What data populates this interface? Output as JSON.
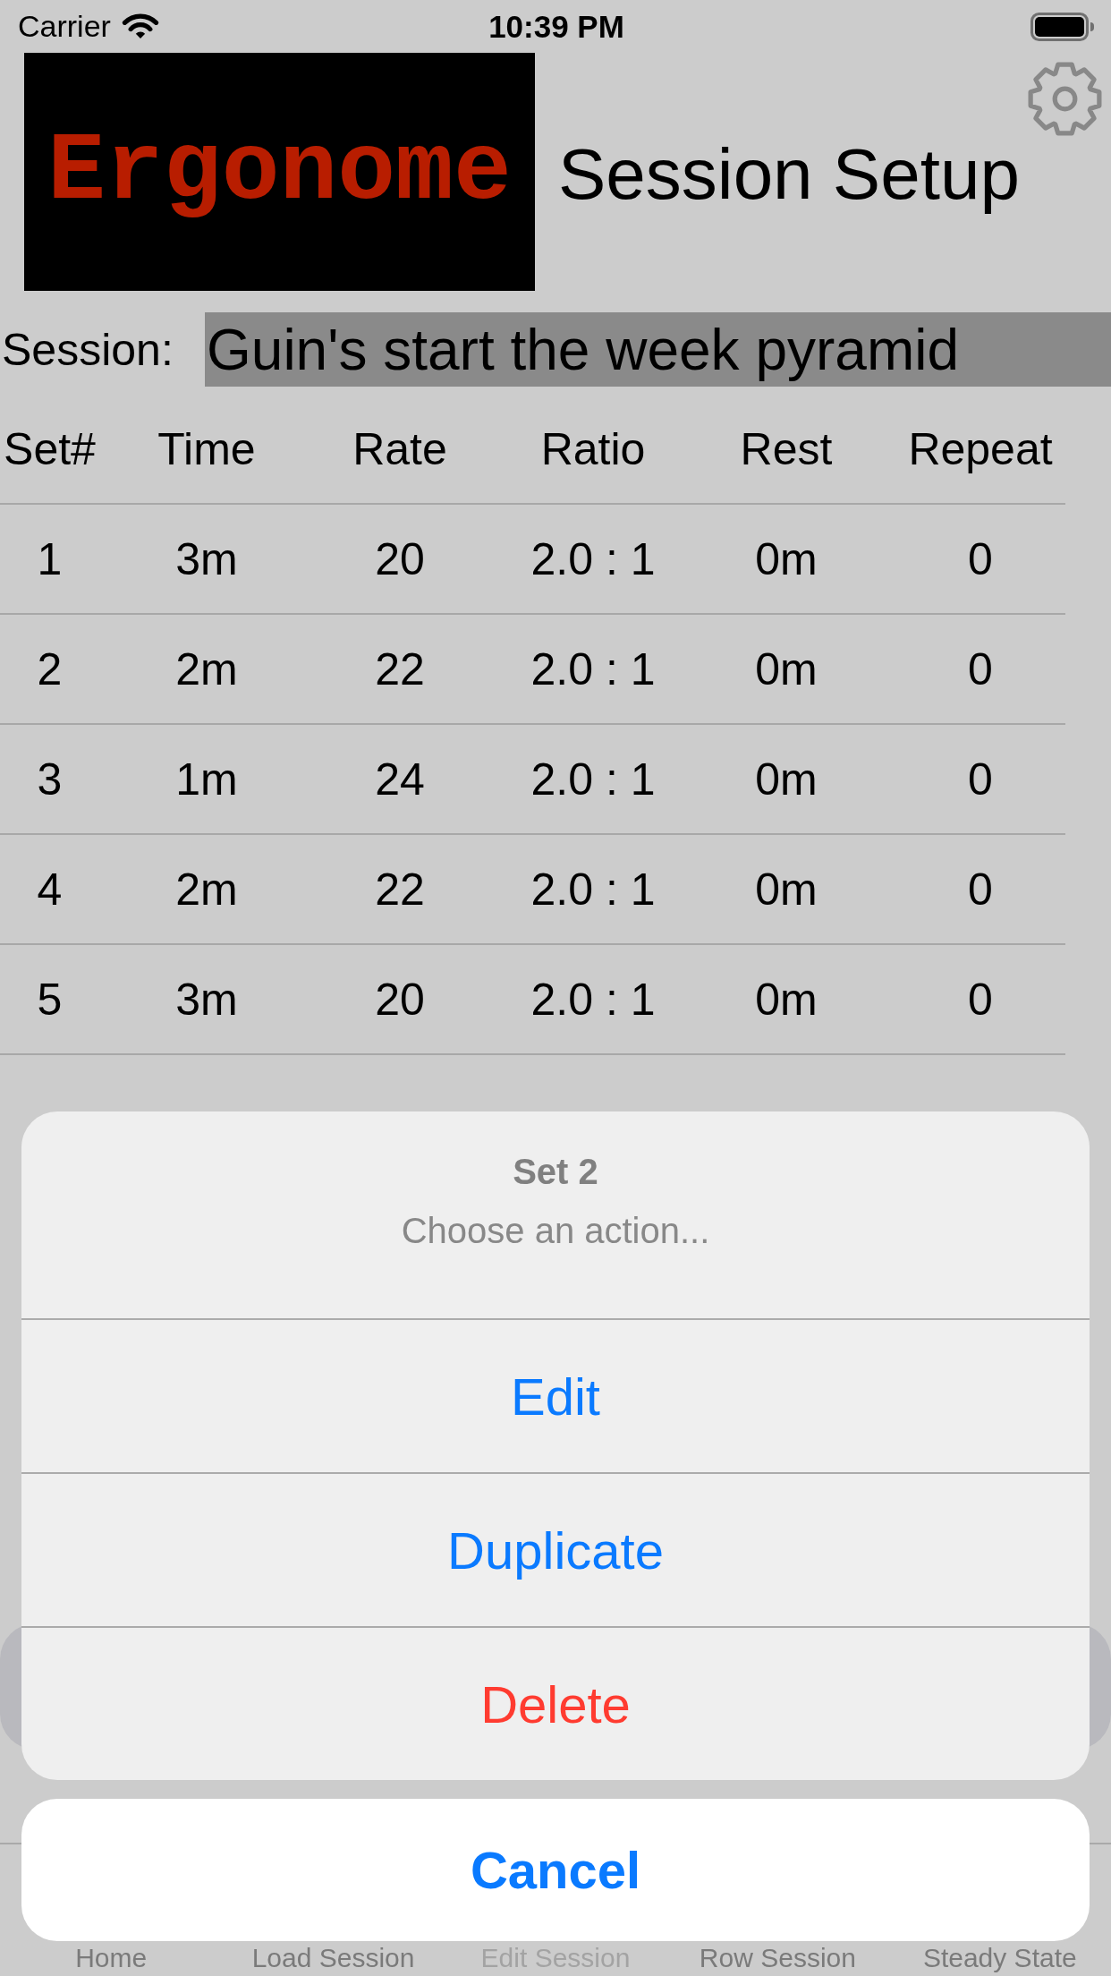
{
  "status_bar": {
    "carrier": "Carrier",
    "time": "10:39 PM"
  },
  "header": {
    "logo": "Ergonome",
    "title": "Session Setup"
  },
  "session": {
    "label": "Session:",
    "value": "Guin's start the week pyramid"
  },
  "table": {
    "columns": [
      "Set#",
      "Time",
      "Rate",
      "Ratio",
      "Rest",
      "Repeat"
    ],
    "rows": [
      [
        "1",
        "3m",
        "20",
        "2.0 : 1",
        "0m",
        "0"
      ],
      [
        "2",
        "2m",
        "22",
        "2.0 : 1",
        "0m",
        "0"
      ],
      [
        "3",
        "1m",
        "24",
        "2.0 : 1",
        "0m",
        "0"
      ],
      [
        "4",
        "2m",
        "22",
        "2.0 : 1",
        "0m",
        "0"
      ],
      [
        "5",
        "3m",
        "20",
        "2.0 : 1",
        "0m",
        "0"
      ]
    ]
  },
  "action_sheet": {
    "title": "Set 2",
    "message": "Choose an action...",
    "actions": [
      {
        "label": "Edit",
        "kind": "default"
      },
      {
        "label": "Duplicate",
        "kind": "default"
      },
      {
        "label": "Delete",
        "kind": "destructive"
      }
    ],
    "cancel": "Cancel"
  },
  "tab_bar": {
    "items": [
      {
        "label": "Home",
        "selected": false
      },
      {
        "label": "Load Session",
        "selected": false
      },
      {
        "label": "Edit Session",
        "selected": true
      },
      {
        "label": "Row Session",
        "selected": false
      },
      {
        "label": "Steady State",
        "selected": false
      }
    ]
  }
}
